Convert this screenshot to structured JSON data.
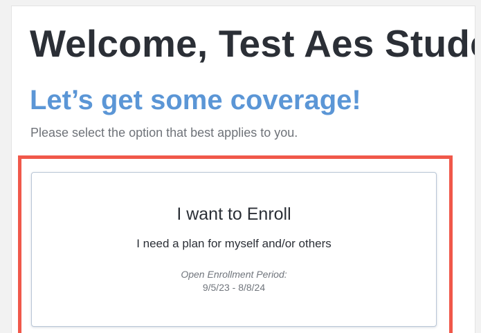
{
  "header": {
    "welcome": "Welcome, Test Aes Student",
    "subtitle": "Let’s get some coverage!",
    "instructions": "Please select the option that best applies to you."
  },
  "enroll_card": {
    "title": "I want to Enroll",
    "description": "I need a plan for myself and/or others",
    "period_label": "Open Enrollment Period:",
    "period_dates": "9/5/23 - 8/8/24"
  },
  "colors": {
    "heading": "#2b2f36",
    "accent": "#5b96d6",
    "highlight": "#f0584a",
    "muted": "#6e7278"
  }
}
